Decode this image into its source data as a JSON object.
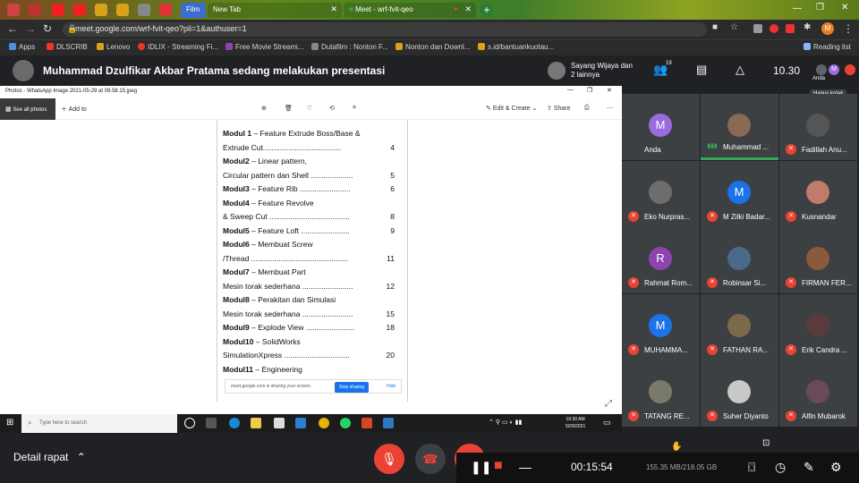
{
  "browser": {
    "tabs": [
      {
        "label": "Film"
      },
      {
        "label": "New Tab"
      },
      {
        "label": "Meet - wrf-fvit-qeo"
      }
    ],
    "url": "meet.google.com/wrf-fvit-qeo?pli=1&authuser=1",
    "bookmarks": [
      "Apps",
      "DLSCRIB",
      "Lenovo",
      "IDLIX - Streaming Fi...",
      "Free Movie Streami...",
      "Dutafilm : Nonton F...",
      "Nonton dan Downl...",
      "s.id/bantuankuotau..."
    ],
    "reading_list": "Reading list"
  },
  "meet": {
    "presenting_title": "Muhammad Dzulfikar Akbar Pratama sedang melakukan presentasi",
    "presenter_chip": "Sayang Wijaya dan 2 lainnya",
    "participant_count": "19",
    "time": "10.30",
    "self_label": "Anda",
    "tooltip": "Hapus kotak",
    "details_label": "Detail rapat"
  },
  "photo_viewer": {
    "title": "Photos - WhatsApp Image 2021-05-29 at 08.58.15.jpeg",
    "see_all": "See all photos",
    "add_to": "Add to",
    "edit_create": "Edit & Create",
    "share": "Share"
  },
  "document": {
    "lines": [
      {
        "bold": "Modul 1",
        "text": " – Feature Extrude Boss/Base &",
        "page": ""
      },
      {
        "bold": "",
        "text": "Extrude Cut.....................................",
        "page": "4"
      },
      {
        "bold": "Modul2",
        "text": " – Linear pattern,",
        "page": ""
      },
      {
        "bold": "",
        "text": "Circular pattern dan Shell ....................",
        "page": "5"
      },
      {
        "bold": "Modul3",
        "text": " – Feature Rib ........................",
        "page": "6"
      },
      {
        "bold": "Modul4",
        "text": " – Feature Revolve",
        "page": ""
      },
      {
        "bold": "",
        "text": "& Sweep Cut ......................................",
        "page": "8"
      },
      {
        "bold": "Modul5",
        "text": " – Feature Loft  .......................",
        "page": "9"
      },
      {
        "bold": "Modul6",
        "text": " – Membuat Screw",
        "page": ""
      },
      {
        "bold": "",
        "text": "/Thread ..............................................",
        "page": "11"
      },
      {
        "bold": "Modul7",
        "text": " – Membuat Part",
        "page": ""
      },
      {
        "bold": "",
        "text": " Mesin torak sederhana ........................",
        "page": "12"
      },
      {
        "bold": "Modul8",
        "text": " – Perakitan dan Simulasi",
        "page": ""
      },
      {
        "bold": "",
        "text": "Mesin torak sederhana  ........................",
        "page": "15"
      },
      {
        "bold": "Modul9",
        "text": " – Explode View  .......................",
        "page": "18"
      },
      {
        "bold": "Modul10",
        "text": " – SolidWorks",
        "page": ""
      },
      {
        "bold": "",
        "text": "SimulationXpress  ...............................",
        "page": "20"
      },
      {
        "bold": "Modul11",
        "text": " – Engineering",
        "page": ""
      }
    ],
    "share_notice": "meet.google.com is sharing your screen.",
    "stop_sharing": "Stop sharing",
    "hide": "Hide"
  },
  "taskbar": {
    "search_placeholder": "Type here to search",
    "clock_time": "10:30 AM",
    "clock_date": "5/29/2021"
  },
  "participants": [
    {
      "name": "Anda",
      "initial": "M",
      "color": "#9c6ade",
      "muted": false
    },
    {
      "name": "Muhammad ...",
      "initial": "",
      "color": "#8a6a55",
      "muted": false,
      "speaking": true
    },
    {
      "name": "Fadillah Anu...",
      "initial": "",
      "color": "#555555",
      "muted": true
    },
    {
      "name": "Eko Nurpras...",
      "initial": "",
      "color": "#6d6d6d",
      "muted": true
    },
    {
      "name": "M Zilki Badar...",
      "initial": "M",
      "color": "#1a73e8",
      "muted": true
    },
    {
      "name": "Kusnandar",
      "initial": "",
      "color": "#c07c6a",
      "muted": true
    },
    {
      "name": "Rahmat Rom...",
      "initial": "R",
      "color": "#8e44ad",
      "muted": true
    },
    {
      "name": "Robinsar Si...",
      "initial": "",
      "color": "#4a6a8a",
      "muted": true
    },
    {
      "name": "FIRMAN FER...",
      "initial": "",
      "color": "#8a5a3a",
      "muted": true
    },
    {
      "name": "MUHAMMA...",
      "initial": "M",
      "color": "#1a73e8",
      "muted": true
    },
    {
      "name": "FATHAN RA...",
      "initial": "",
      "color": "#7a6a4a",
      "muted": true
    },
    {
      "name": "Erik Candra ...",
      "initial": "",
      "color": "#5a3a3a",
      "muted": true
    },
    {
      "name": "TATANG RE...",
      "initial": "",
      "color": "#7a7a6a",
      "muted": true
    },
    {
      "name": "Suher Diyanto",
      "initial": "",
      "color": "#c8c8c8",
      "muted": true
    },
    {
      "name": "Alfin Mubarok",
      "initial": "",
      "color": "#6a4a5a",
      "muted": true
    }
  ],
  "recorder": {
    "elapsed": "00:15:54",
    "size": "155.35 MB/218.05 GB"
  }
}
